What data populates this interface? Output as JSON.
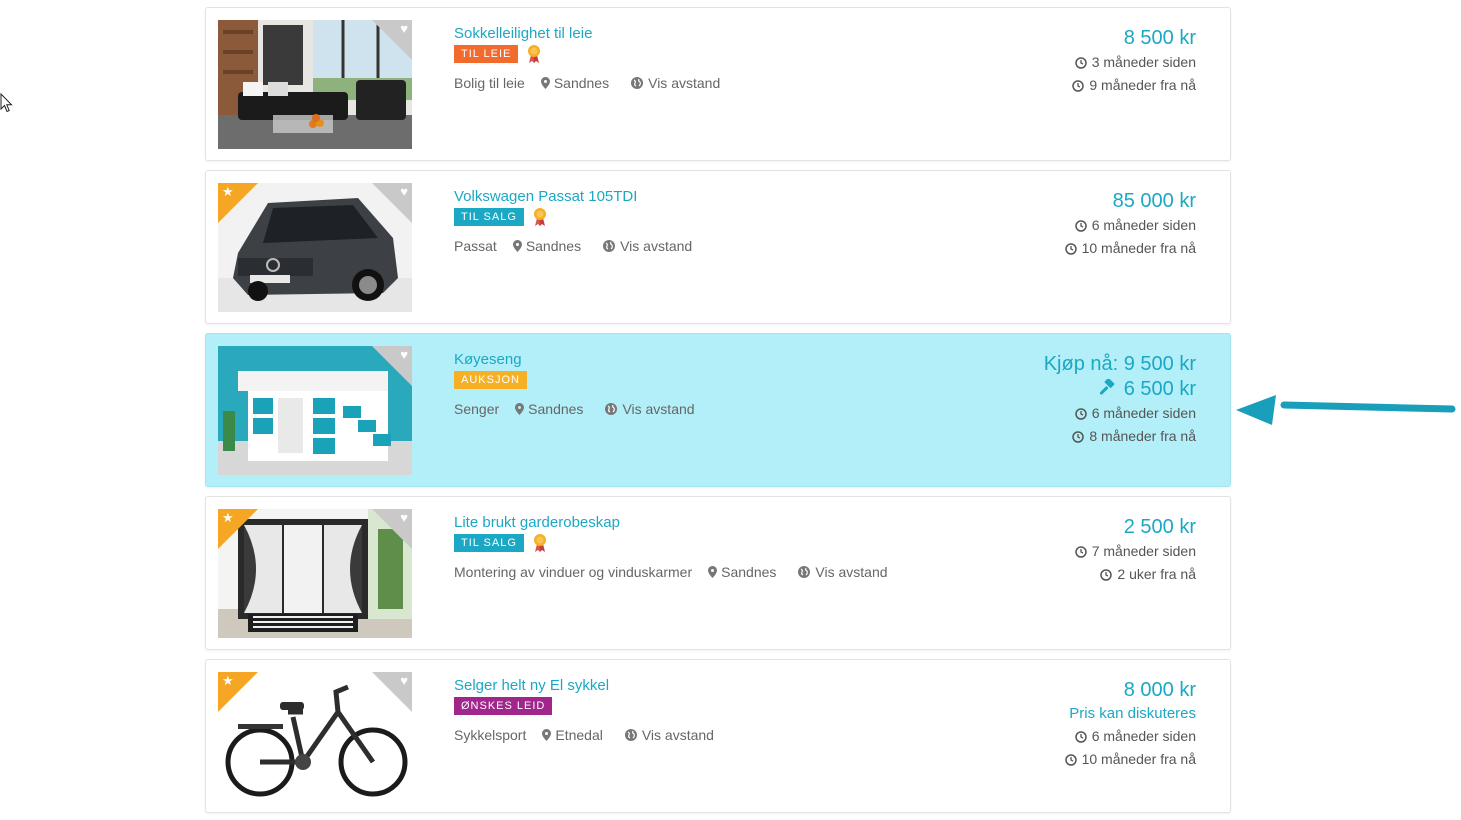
{
  "listings": [
    {
      "title": "Sokkelleilighet til leie",
      "badge": "TIL LEIE",
      "category": "Bolig til leie",
      "location": "Sandnes",
      "distance_label": "Vis avstand",
      "price": "8 500 kr",
      "posted": "3 måneder siden",
      "expires": "9 måneder fra nå"
    },
    {
      "title": "Volkswagen Passat 105TDI",
      "badge": "TIL SALG",
      "category": "Passat",
      "location": "Sandnes",
      "distance_label": "Vis avstand",
      "price": "85 000 kr",
      "posted": "6 måneder siden",
      "expires": "10 måneder fra nå"
    },
    {
      "title": "Køyeseng",
      "badge": "AUKSJON",
      "category": "Senger",
      "location": "Sandnes",
      "distance_label": "Vis avstand",
      "buy_now": "Kjøp nå: 9 500 kr",
      "bid": "6 500 kr",
      "posted": "6 måneder siden",
      "expires": "8 måneder fra nå"
    },
    {
      "title": "Lite brukt garderobeskap",
      "badge": "TIL SALG",
      "category": "Montering av vinduer og vinduskarmer",
      "location": "Sandnes",
      "distance_label": "Vis avstand",
      "price": "2 500 kr",
      "posted": "7 måneder siden",
      "expires": "2 uker fra nå"
    },
    {
      "title": "Selger helt ny El sykkel",
      "badge": "ØNSKES LEID",
      "category": "Sykkelsport",
      "location": "Etnedal",
      "distance_label": "Vis avstand",
      "price": "8 000 kr",
      "price_note": "Pris kan diskuteres",
      "posted": "6 måneder siden",
      "expires": "10 måneder fra nå"
    }
  ],
  "colors": {
    "accent": "#1ba8c4",
    "highlight_bg": "#b3eff8",
    "badge_leie": "#f26b2c",
    "badge_salg": "#1ba8c4",
    "badge_auksjon": "#f5b025",
    "badge_onskes": "#a0268c",
    "featured_corner": "#f5a623"
  },
  "icons": [
    "heart-icon",
    "star-icon",
    "medal-icon",
    "pin-icon",
    "globe-icon",
    "clock-icon",
    "gavel-icon",
    "arrow-annotation",
    "mouse-cursor"
  ]
}
